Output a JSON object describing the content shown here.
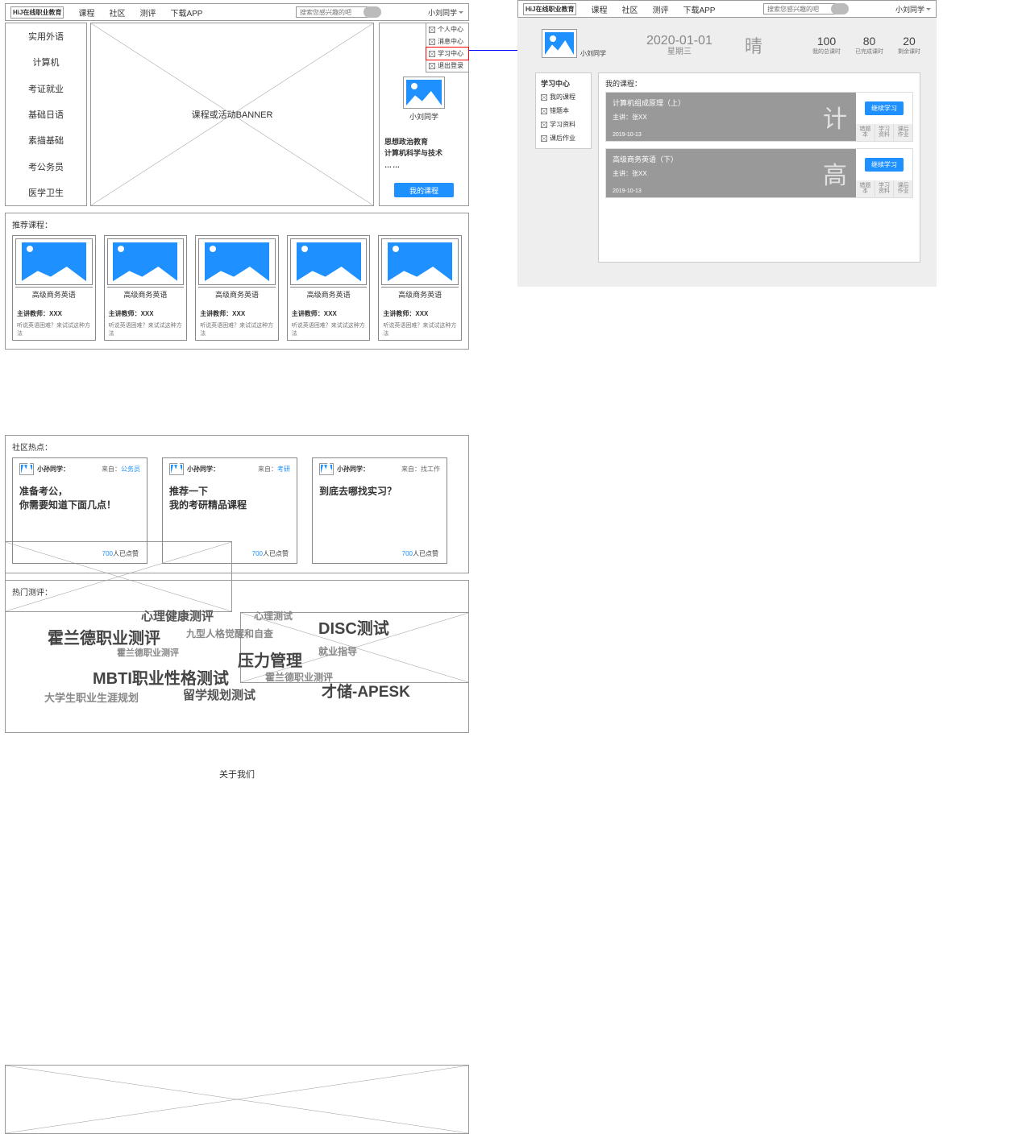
{
  "logo_text": "HiJ在线职业教育",
  "nav": [
    "课程",
    "社区",
    "测评",
    "下载APP"
  ],
  "search_placeholder": "搜索您感兴趣的吧",
  "user_name": "小刘同学",
  "user_menu": [
    {
      "label": "个人中心",
      "active": false
    },
    {
      "label": "消息中心",
      "active": false
    },
    {
      "label": "学习中心",
      "active": true
    },
    {
      "label": "退出登录",
      "active": false
    }
  ],
  "banner_text": "课程或活动BANNER",
  "left_categories": [
    "实用外语",
    "计算机",
    "考证就业",
    "基础日语",
    "素描基础",
    "考公务员",
    "医学卫生"
  ],
  "user_card": {
    "name": "小刘同学",
    "lines": [
      "思想政治教育",
      "计算机科学与技术",
      "……"
    ],
    "btn": "我的课程"
  },
  "recommend": {
    "title": "推荐课程：",
    "card": {
      "title": "高级商务英语",
      "teacher": "主讲教师：XXX",
      "desc": "听说英语困难？来试试这种方法"
    }
  },
  "community": {
    "title": "社区热点：",
    "cards": [
      {
        "user": "小孙同学：",
        "from_label": "来自：",
        "from": "公务员",
        "from_link": true,
        "body1": "准备考公，",
        "body2": "你需要知道下面几点！",
        "likes": "700",
        "likes_suffix": "人已点赞"
      },
      {
        "user": "小孙同学：",
        "from_label": "来自：",
        "from": "考研",
        "from_link": true,
        "body1": "推荐一下",
        "body2": "我的考研精品课程",
        "likes": "700",
        "likes_suffix": "人已点赞"
      },
      {
        "user": "小孙同学：",
        "from_label": "来自：",
        "from": "找工作",
        "from_link": false,
        "body1": "到底去哪找实习？",
        "body2": "",
        "likes": "700",
        "likes_suffix": "人已点赞"
      }
    ]
  },
  "hot": {
    "title": "热门测评：",
    "words": [
      "心理健康测评",
      "心理测试",
      "霍兰德职业测评",
      "九型人格觉醒和自查",
      "DISC测试",
      "霍兰德职业测评",
      "压力管理",
      "就业指导",
      "MBTI职业性格测试",
      "霍兰德职业测评",
      "大学生职业生涯规划",
      "留学规划测试",
      "才储-APESK"
    ]
  },
  "about_text": "关于我们",
  "learning": {
    "user": "小刘同学",
    "date": "2020-01-01",
    "weekday": "星期三",
    "weather": "晴",
    "stats": [
      {
        "n": "100",
        "l": "我的总课时"
      },
      {
        "n": "80",
        "l": "已完成课时"
      },
      {
        "n": "20",
        "l": "剩余课时"
      }
    ],
    "sidebar_title": "学习中心",
    "sidebar": [
      "我的课程",
      "错题本",
      "学习资料",
      "课后作业"
    ],
    "main_title": "我的课程：",
    "continue_btn": "继续学习",
    "actions": [
      "错题本",
      "学习资料",
      "课后作业"
    ],
    "courses": [
      {
        "title": "计算机组成原理（上）",
        "teacher": "主讲：张XX",
        "date": "2019-10-13",
        "char": "计"
      },
      {
        "title": "高级商务英语（下）",
        "teacher": "主讲：张XX",
        "date": "2019-10-13",
        "char": "高"
      }
    ]
  }
}
